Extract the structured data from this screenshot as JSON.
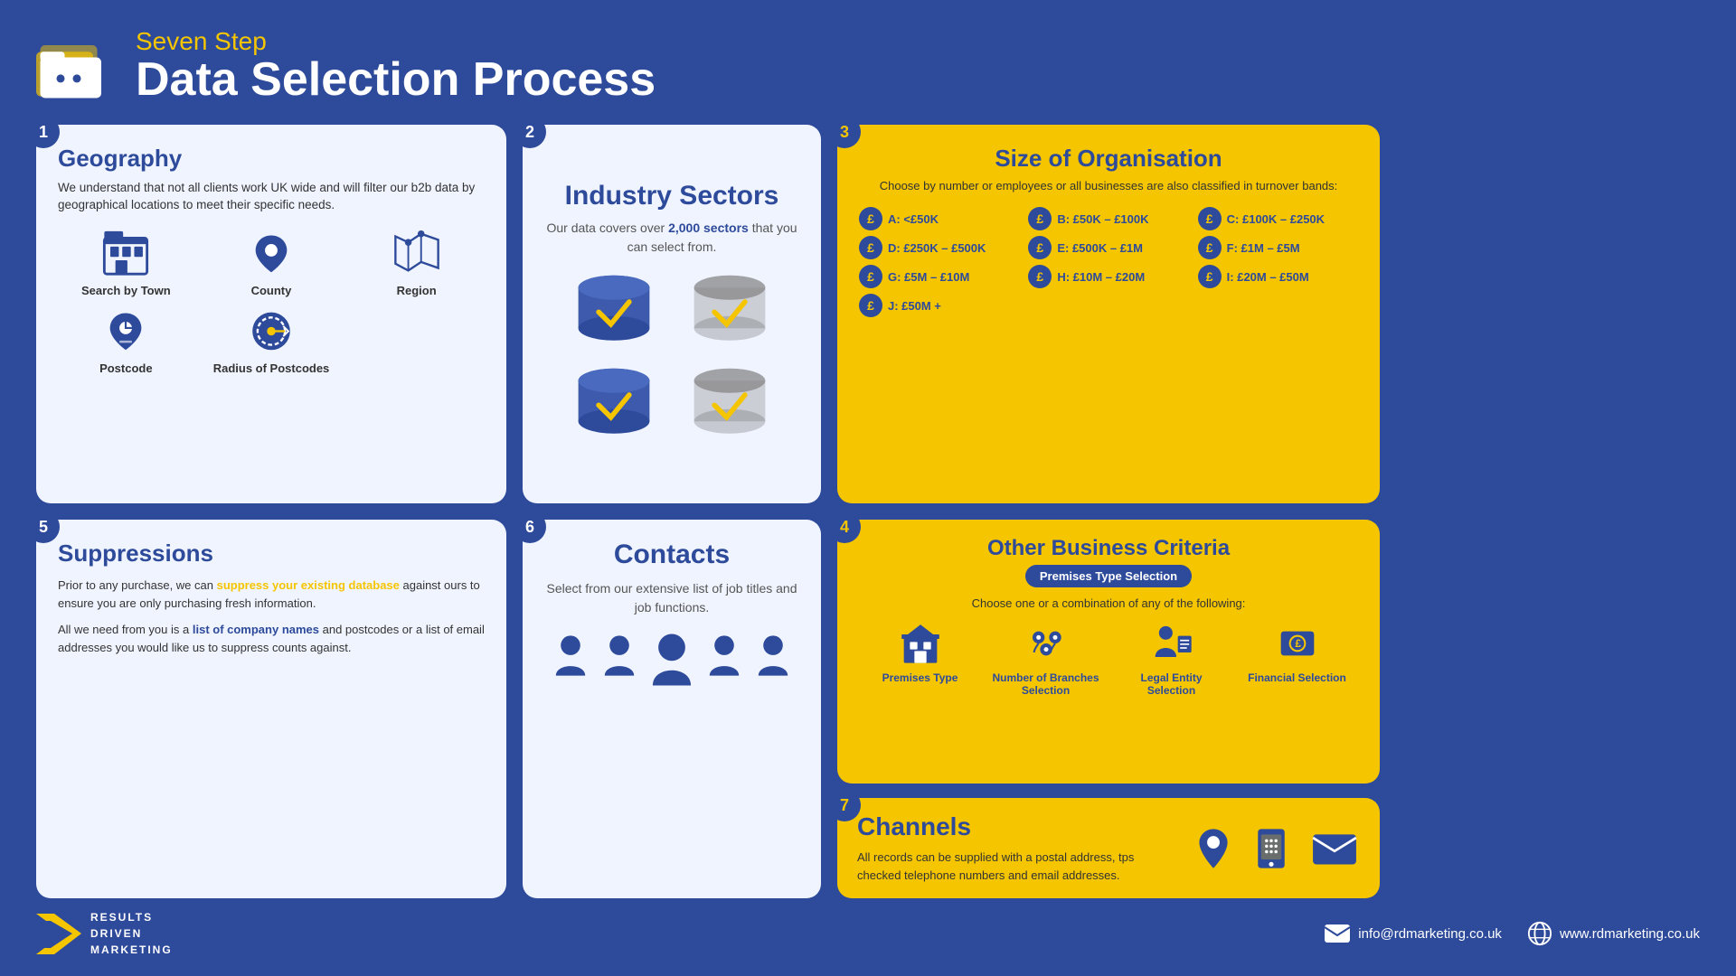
{
  "header": {
    "subtitle": "Seven Step",
    "title": "Data Selection Process"
  },
  "steps": {
    "step1": {
      "number": "1",
      "title": "Geography",
      "desc": "We understand that not all clients work UK wide and will filter our b2b data by geographical locations to meet their specific needs.",
      "icons": [
        {
          "label": "Search by Town",
          "icon": "building"
        },
        {
          "label": "County",
          "icon": "map-pin"
        },
        {
          "label": "Region",
          "icon": "map-region"
        },
        {
          "label": "Postcode",
          "icon": "postcode"
        },
        {
          "label": "Radius of Postcodes",
          "icon": "radius"
        }
      ]
    },
    "step2": {
      "number": "2",
      "title": "Industry Sectors",
      "desc": "Our data covers over 2,000 sectors that you can select from.",
      "highlight": "2,000"
    },
    "step3": {
      "number": "3",
      "title": "Size of Organisation",
      "subtitle": "Choose by number or employees or all businesses are also classified in turnover bands:",
      "bands": [
        {
          "letter": "A",
          "range": "A: <£50K"
        },
        {
          "letter": "B",
          "range": "B: £50K – £100K"
        },
        {
          "letter": "C",
          "range": "C: £100K – £250K"
        },
        {
          "letter": "D",
          "range": "D: £250K – £500K"
        },
        {
          "letter": "E",
          "range": "E: £500K – £1M"
        },
        {
          "letter": "F",
          "range": "F: £1M – £5M"
        },
        {
          "letter": "G",
          "range": "G: £5M – £10M"
        },
        {
          "letter": "H",
          "range": "H: £10M – £20M"
        },
        {
          "letter": "I",
          "range": "I: £20M – £50M"
        },
        {
          "letter": "J",
          "range": "J: £50M +"
        }
      ]
    },
    "step4": {
      "number": "4",
      "title": "Other Business Criteria",
      "badge": "Premises Type Selection",
      "subtitle": "Choose one or a combination of any of the following:",
      "criteria": [
        {
          "label": "Premises Type"
        },
        {
          "label": "Number of Branches Selection"
        },
        {
          "label": "Legal Entity Selection"
        },
        {
          "label": "Financial Selection"
        }
      ]
    },
    "step5": {
      "number": "5",
      "title": "Suppressions",
      "text1": "Prior to any purchase, we can suppress your existing database against ours to ensure you are only purchasing fresh information.",
      "text2_pre": "All we need from you is a ",
      "text2_highlight": "list of company names",
      "text2_post": " and postcodes or a list of email addresses you would like us to suppress counts against.",
      "highlight1": "suppress your existing database"
    },
    "step6": {
      "number": "6",
      "title": "Contacts",
      "desc": "Select from our extensive list of job titles and job functions."
    },
    "step7": {
      "number": "7",
      "title": "Channels",
      "desc": "All records can be supplied with a postal address, tps checked telephone numbers and email addresses."
    }
  },
  "footer": {
    "logo_lines": [
      "RESULTS",
      "DRIVEN",
      "MARKETING"
    ],
    "email": "info@rdmarketing.co.uk",
    "website": "www.rdmarketing.co.uk"
  },
  "colors": {
    "blue": "#2d4a9b",
    "yellow": "#f5c500",
    "white": "#ffffff",
    "light_bg": "#f0f4ff",
    "dark_text": "#333333"
  }
}
